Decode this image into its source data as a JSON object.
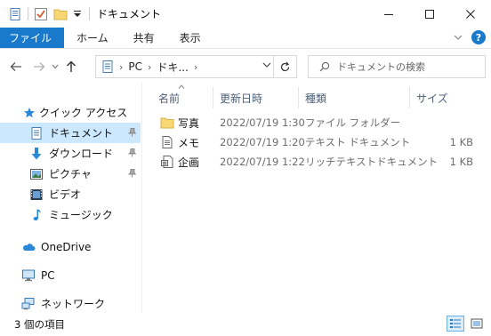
{
  "window": {
    "title": "ドキュメント",
    "minimize_glyph": "—",
    "maximize_glyph": "☐",
    "close_glyph": "✕"
  },
  "ribbon": {
    "tabs": [
      "ファイル",
      "ホーム",
      "共有",
      "表示"
    ],
    "file_color": "#1979ca",
    "help_glyph": "?"
  },
  "nav": {
    "back_glyph": "←",
    "forward_glyph": "→",
    "recent_glyph": "⌄",
    "up_glyph": "↑",
    "breadcrumb": [
      "PC",
      "ドキ..."
    ],
    "crumb_sep": "›",
    "refresh_glyph": "↻"
  },
  "search": {
    "placeholder": "ドキュメントの検索"
  },
  "sidebar": {
    "items": [
      {
        "label": "クイック アクセス",
        "icon": "star-icon",
        "pinned": false,
        "selected": false
      },
      {
        "label": "ドキュメント",
        "icon": "document-icon",
        "pinned": true,
        "selected": true
      },
      {
        "label": "ダウンロード",
        "icon": "download-icon",
        "pinned": true,
        "selected": false
      },
      {
        "label": "ピクチャ",
        "icon": "pictures-icon",
        "pinned": true,
        "selected": false
      },
      {
        "label": "ビデオ",
        "icon": "video-icon",
        "pinned": false,
        "selected": false
      },
      {
        "label": "ミュージック",
        "icon": "music-icon",
        "pinned": false,
        "selected": false
      },
      {
        "label": "OneDrive",
        "icon": "cloud-icon",
        "pinned": false,
        "selected": false
      },
      {
        "label": "PC",
        "icon": "computer-icon",
        "pinned": false,
        "selected": false
      },
      {
        "label": "ネットワーク",
        "icon": "network-icon",
        "pinned": false,
        "selected": false
      }
    ]
  },
  "files": {
    "columns": [
      "名前",
      "更新日時",
      "種類",
      "サイズ"
    ],
    "rows": [
      {
        "name": "写真",
        "modified": "2022/07/19 1:30",
        "type": "ファイル フォルダー",
        "size": "",
        "icon": "folder-icon"
      },
      {
        "name": "メモ",
        "modified": "2022/07/19 1:20",
        "type": "テキスト ドキュメント",
        "size": "1 KB",
        "icon": "text-file-icon"
      },
      {
        "name": "企画",
        "modified": "2022/07/19 1:22",
        "type": "リッチテキストドキュメント",
        "size": "1 KB",
        "icon": "rtf-file-icon"
      }
    ]
  },
  "status": {
    "item_count": "3 個の項目"
  },
  "colors": {
    "accent": "#1979ca",
    "selected_bg": "#cce8ff",
    "folder": "#f8d775",
    "header_text": "#4c607a"
  }
}
